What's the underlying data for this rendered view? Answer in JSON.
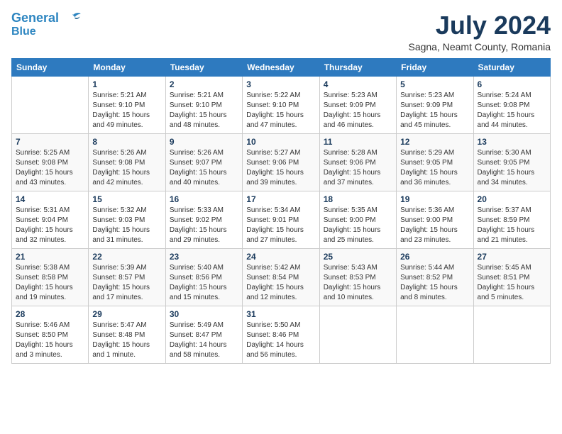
{
  "header": {
    "logo_line1": "General",
    "logo_line2": "Blue",
    "month_year": "July 2024",
    "location": "Sagna, Neamt County, Romania"
  },
  "weekdays": [
    "Sunday",
    "Monday",
    "Tuesday",
    "Wednesday",
    "Thursday",
    "Friday",
    "Saturday"
  ],
  "weeks": [
    [
      {
        "day": "",
        "info": ""
      },
      {
        "day": "1",
        "info": "Sunrise: 5:21 AM\nSunset: 9:10 PM\nDaylight: 15 hours\nand 49 minutes."
      },
      {
        "day": "2",
        "info": "Sunrise: 5:21 AM\nSunset: 9:10 PM\nDaylight: 15 hours\nand 48 minutes."
      },
      {
        "day": "3",
        "info": "Sunrise: 5:22 AM\nSunset: 9:10 PM\nDaylight: 15 hours\nand 47 minutes."
      },
      {
        "day": "4",
        "info": "Sunrise: 5:23 AM\nSunset: 9:09 PM\nDaylight: 15 hours\nand 46 minutes."
      },
      {
        "day": "5",
        "info": "Sunrise: 5:23 AM\nSunset: 9:09 PM\nDaylight: 15 hours\nand 45 minutes."
      },
      {
        "day": "6",
        "info": "Sunrise: 5:24 AM\nSunset: 9:08 PM\nDaylight: 15 hours\nand 44 minutes."
      }
    ],
    [
      {
        "day": "7",
        "info": "Sunrise: 5:25 AM\nSunset: 9:08 PM\nDaylight: 15 hours\nand 43 minutes."
      },
      {
        "day": "8",
        "info": "Sunrise: 5:26 AM\nSunset: 9:08 PM\nDaylight: 15 hours\nand 42 minutes."
      },
      {
        "day": "9",
        "info": "Sunrise: 5:26 AM\nSunset: 9:07 PM\nDaylight: 15 hours\nand 40 minutes."
      },
      {
        "day": "10",
        "info": "Sunrise: 5:27 AM\nSunset: 9:06 PM\nDaylight: 15 hours\nand 39 minutes."
      },
      {
        "day": "11",
        "info": "Sunrise: 5:28 AM\nSunset: 9:06 PM\nDaylight: 15 hours\nand 37 minutes."
      },
      {
        "day": "12",
        "info": "Sunrise: 5:29 AM\nSunset: 9:05 PM\nDaylight: 15 hours\nand 36 minutes."
      },
      {
        "day": "13",
        "info": "Sunrise: 5:30 AM\nSunset: 9:05 PM\nDaylight: 15 hours\nand 34 minutes."
      }
    ],
    [
      {
        "day": "14",
        "info": "Sunrise: 5:31 AM\nSunset: 9:04 PM\nDaylight: 15 hours\nand 32 minutes."
      },
      {
        "day": "15",
        "info": "Sunrise: 5:32 AM\nSunset: 9:03 PM\nDaylight: 15 hours\nand 31 minutes."
      },
      {
        "day": "16",
        "info": "Sunrise: 5:33 AM\nSunset: 9:02 PM\nDaylight: 15 hours\nand 29 minutes."
      },
      {
        "day": "17",
        "info": "Sunrise: 5:34 AM\nSunset: 9:01 PM\nDaylight: 15 hours\nand 27 minutes."
      },
      {
        "day": "18",
        "info": "Sunrise: 5:35 AM\nSunset: 9:00 PM\nDaylight: 15 hours\nand 25 minutes."
      },
      {
        "day": "19",
        "info": "Sunrise: 5:36 AM\nSunset: 9:00 PM\nDaylight: 15 hours\nand 23 minutes."
      },
      {
        "day": "20",
        "info": "Sunrise: 5:37 AM\nSunset: 8:59 PM\nDaylight: 15 hours\nand 21 minutes."
      }
    ],
    [
      {
        "day": "21",
        "info": "Sunrise: 5:38 AM\nSunset: 8:58 PM\nDaylight: 15 hours\nand 19 minutes."
      },
      {
        "day": "22",
        "info": "Sunrise: 5:39 AM\nSunset: 8:57 PM\nDaylight: 15 hours\nand 17 minutes."
      },
      {
        "day": "23",
        "info": "Sunrise: 5:40 AM\nSunset: 8:56 PM\nDaylight: 15 hours\nand 15 minutes."
      },
      {
        "day": "24",
        "info": "Sunrise: 5:42 AM\nSunset: 8:54 PM\nDaylight: 15 hours\nand 12 minutes."
      },
      {
        "day": "25",
        "info": "Sunrise: 5:43 AM\nSunset: 8:53 PM\nDaylight: 15 hours\nand 10 minutes."
      },
      {
        "day": "26",
        "info": "Sunrise: 5:44 AM\nSunset: 8:52 PM\nDaylight: 15 hours\nand 8 minutes."
      },
      {
        "day": "27",
        "info": "Sunrise: 5:45 AM\nSunset: 8:51 PM\nDaylight: 15 hours\nand 5 minutes."
      }
    ],
    [
      {
        "day": "28",
        "info": "Sunrise: 5:46 AM\nSunset: 8:50 PM\nDaylight: 15 hours\nand 3 minutes."
      },
      {
        "day": "29",
        "info": "Sunrise: 5:47 AM\nSunset: 8:48 PM\nDaylight: 15 hours\nand 1 minute."
      },
      {
        "day": "30",
        "info": "Sunrise: 5:49 AM\nSunset: 8:47 PM\nDaylight: 14 hours\nand 58 minutes."
      },
      {
        "day": "31",
        "info": "Sunrise: 5:50 AM\nSunset: 8:46 PM\nDaylight: 14 hours\nand 56 minutes."
      },
      {
        "day": "",
        "info": ""
      },
      {
        "day": "",
        "info": ""
      },
      {
        "day": "",
        "info": ""
      }
    ]
  ]
}
